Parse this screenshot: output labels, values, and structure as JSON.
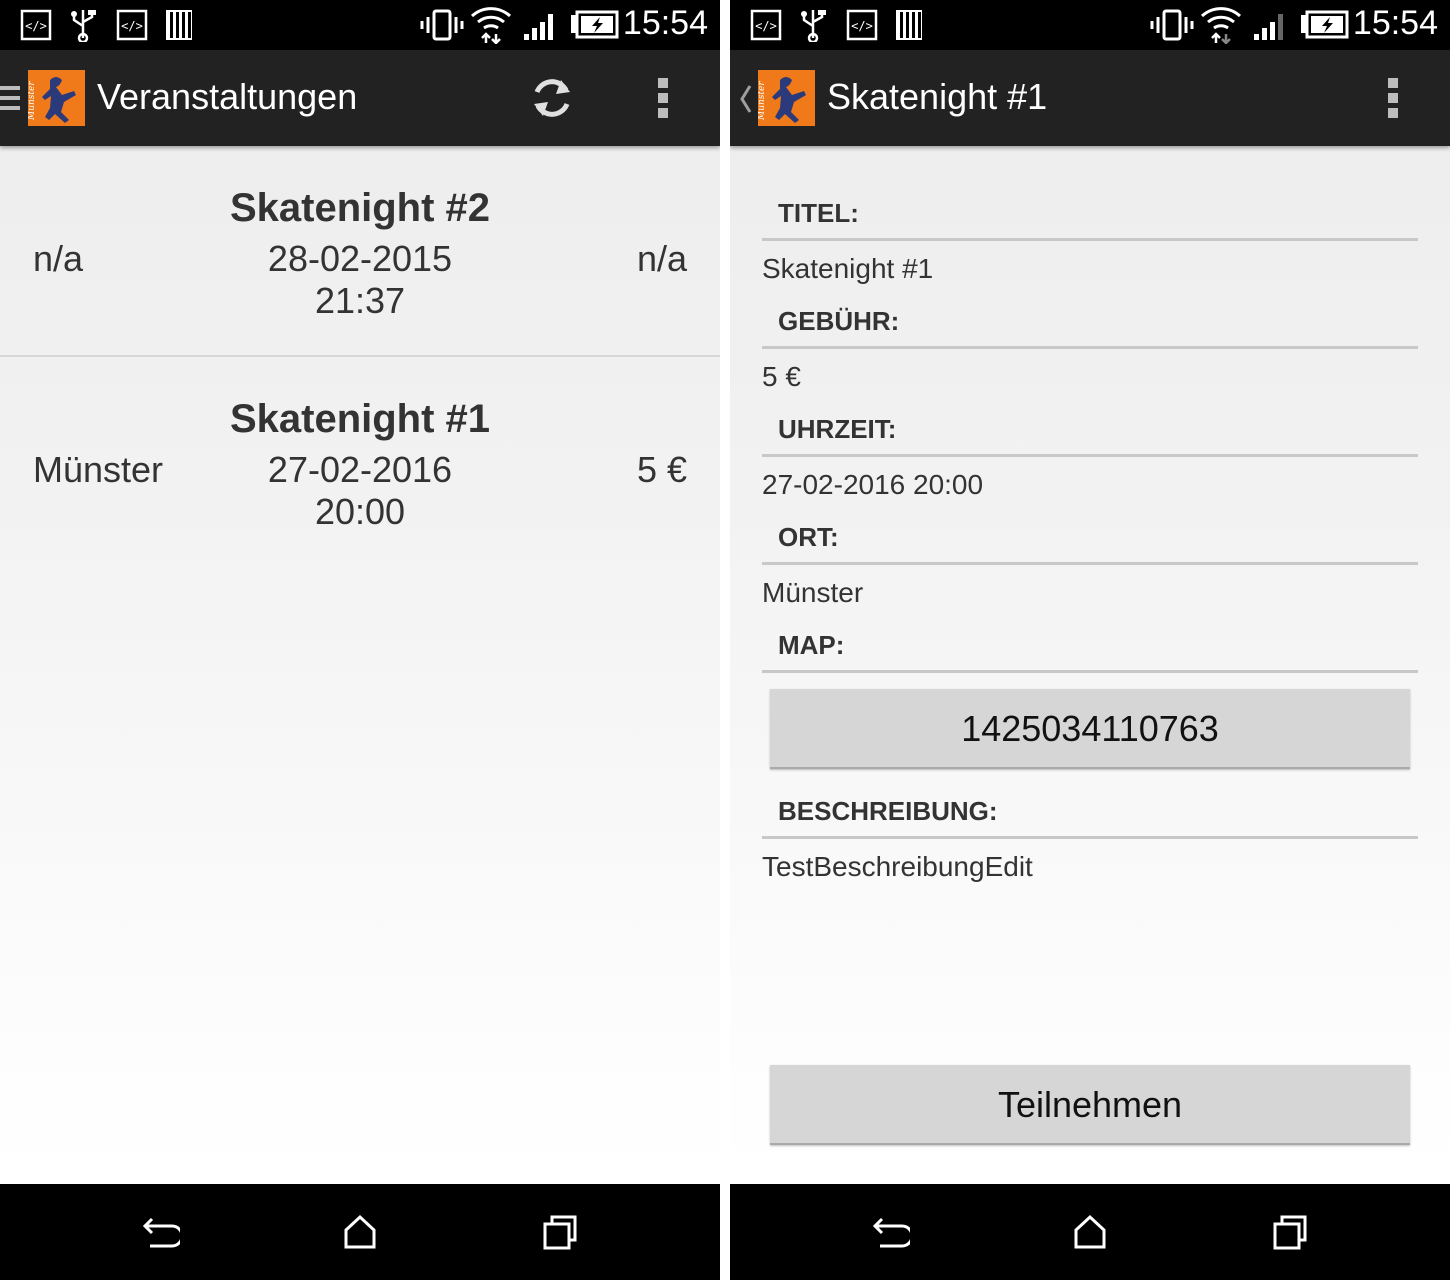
{
  "status_bar": {
    "time": "15:54"
  },
  "list_screen": {
    "title": "Veranstaltungen",
    "events": [
      {
        "title": "Skatenight #2",
        "date": "28-02-2015",
        "time": "21:37",
        "location": "n/a",
        "fee": "n/a"
      },
      {
        "title": "Skatenight #1",
        "date": "27-02-2016",
        "time": "20:00",
        "location": "Münster",
        "fee": "5 €"
      }
    ]
  },
  "detail_screen": {
    "title": "Skatenight #1",
    "fields": {
      "titel_label": "TITEL:",
      "titel_value": "Skatenight #1",
      "gebuehr_label": "GEBÜHR:",
      "gebuehr_value": "5 €",
      "uhrzeit_label": "UHRZEIT:",
      "uhrzeit_value": "27-02-2016 20:00",
      "ort_label": "ORT:",
      "ort_value": "Münster",
      "map_label": "MAP:",
      "map_button": "1425034110763",
      "beschreibung_label": "BESCHREIBUNG:",
      "beschreibung_value": "TestBeschreibungEdit"
    },
    "join_button": "Teilnehmen"
  },
  "colors": {
    "action_bar": "#222222",
    "logo": "#f07a1a",
    "status_bar": "#000000",
    "button": "#d6d6d6"
  },
  "icons": [
    "dev-code-icon",
    "usb-icon",
    "sd-card-icon",
    "vibrate-icon",
    "wifi-icon",
    "signal-icon",
    "battery-charging-icon",
    "menu-icon",
    "refresh-icon",
    "overflow-menu-icon",
    "back-icon",
    "home-icon",
    "recent-apps-icon",
    "up-caret-icon"
  ]
}
